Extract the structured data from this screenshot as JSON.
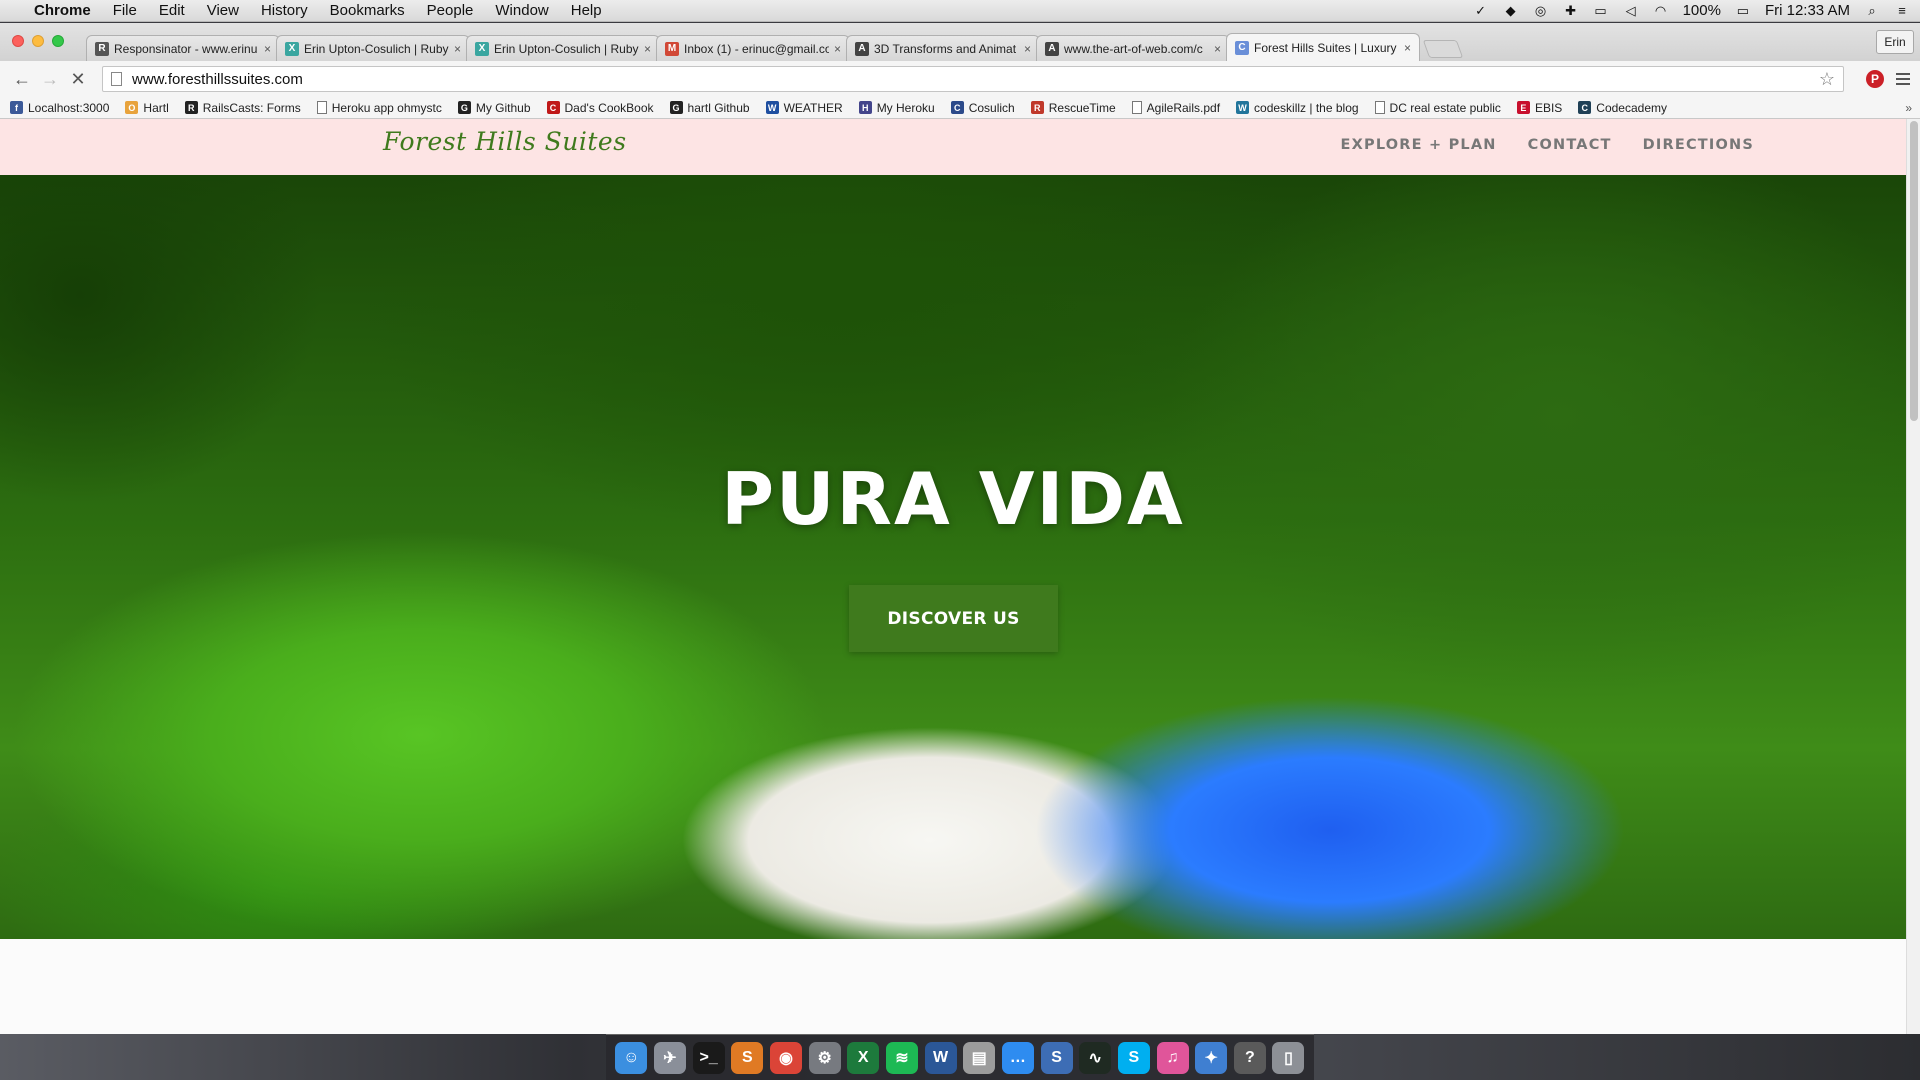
{
  "menubar": {
    "app_name": "Chrome",
    "items": [
      "File",
      "Edit",
      "View",
      "History",
      "Bookmarks",
      "People",
      "Window",
      "Help"
    ],
    "battery": "100%",
    "clock": "Fri 12:33 AM"
  },
  "tabs": [
    {
      "title": "Responsinator - www.erinu",
      "icon": "R",
      "color": "#555555"
    },
    {
      "title": "Erin Upton-Cosulich | Ruby",
      "icon": "X",
      "color": "#3aa6a0"
    },
    {
      "title": "Erin Upton-Cosulich | Ruby",
      "icon": "X",
      "color": "#3aa6a0"
    },
    {
      "title": "Inbox (1) - erinuc@gmail.co",
      "icon": "M",
      "color": "#d14836"
    },
    {
      "title": "3D Transforms and Animat",
      "icon": "A",
      "color": "#444444"
    },
    {
      "title": "www.the-art-of-web.com/c",
      "icon": "A",
      "color": "#444444"
    },
    {
      "title": "Forest Hills Suites | Luxury",
      "icon": "C",
      "color": "#6a8fd8"
    }
  ],
  "profile_name": "Erin",
  "address_bar": {
    "url": "www.foresthillssuites.com"
  },
  "bookmarks": [
    {
      "label": "Localhost:3000",
      "icon": "f",
      "color": "#3b5998"
    },
    {
      "label": "Hartl",
      "icon": "O",
      "color": "#e8a33c"
    },
    {
      "label": "RailsCasts: Forms",
      "icon": "R",
      "color": "#222222"
    },
    {
      "label": "Heroku app ohmystc",
      "icon": "doc",
      "color": "#ffffff"
    },
    {
      "label": "My Github",
      "icon": "G",
      "color": "#222222"
    },
    {
      "label": "Dad's CookBook",
      "icon": "C",
      "color": "#c01818"
    },
    {
      "label": "hartl Github",
      "icon": "G",
      "color": "#222222"
    },
    {
      "label": "WEATHER",
      "icon": "W",
      "color": "#1f4fa0"
    },
    {
      "label": "My Heroku",
      "icon": "H",
      "color": "#43458b"
    },
    {
      "label": "Cosulich",
      "icon": "C",
      "color": "#2c4a8a"
    },
    {
      "label": "RescueTime",
      "icon": "R",
      "color": "#c0392b"
    },
    {
      "label": "AgileRails.pdf",
      "icon": "doc",
      "color": "#ffffff"
    },
    {
      "label": "codeskillz | the blog",
      "icon": "W",
      "color": "#21759b"
    },
    {
      "label": "DC real estate public",
      "icon": "doc",
      "color": "#ffffff"
    },
    {
      "label": "EBIS",
      "icon": "E",
      "color": "#c8102e"
    },
    {
      "label": "Codecademy",
      "icon": "C",
      "color": "#1f4056"
    }
  ],
  "site": {
    "logo": "Forest Hills Suites",
    "nav": [
      "EXPLORE + PLAN",
      "CONTACT",
      "DIRECTIONS"
    ],
    "hero_title": "PURA VIDA",
    "hero_button": "DISCOVER US",
    "brand_color": "#3f7a1d",
    "nav_background": "#fde4e4"
  },
  "dock": [
    {
      "name": "finder-icon",
      "glyph": "☺",
      "color": "#3b8fe0"
    },
    {
      "name": "launchpad-icon",
      "glyph": "✈",
      "color": "#8a8f99"
    },
    {
      "name": "terminal-icon",
      "glyph": ">_",
      "color": "#1a1a1a"
    },
    {
      "name": "sublime-icon",
      "glyph": "S",
      "color": "#e07a24"
    },
    {
      "name": "chrome-icon",
      "glyph": "◉",
      "color": "#db4437"
    },
    {
      "name": "system-preferences-icon",
      "glyph": "⚙",
      "color": "#777a80"
    },
    {
      "name": "excel-icon",
      "glyph": "X",
      "color": "#1d7a3c"
    },
    {
      "name": "spotify-icon",
      "glyph": "≋",
      "color": "#1db954"
    },
    {
      "name": "word-icon",
      "glyph": "W",
      "color": "#2b5797"
    },
    {
      "name": "notes-icon",
      "glyph": "▤",
      "color": "#9c9c9c"
    },
    {
      "name": "messages-icon",
      "glyph": "…",
      "color": "#2e8cf0"
    },
    {
      "name": "scrivener-icon",
      "glyph": "S",
      "color": "#3d6db5"
    },
    {
      "name": "activity-monitor-icon",
      "glyph": "∿",
      "color": "#1f2a22"
    },
    {
      "name": "skype-icon",
      "glyph": "S",
      "color": "#00aff0"
    },
    {
      "name": "itunes-icon",
      "glyph": "♫",
      "color": "#e0559a"
    },
    {
      "name": "xcode-icon",
      "glyph": "✦",
      "color": "#3f7fd1"
    },
    {
      "name": "help-icon",
      "glyph": "?",
      "color": "#5a5a5a"
    },
    {
      "name": "trash-icon",
      "glyph": "▯",
      "color": "#8d9096"
    }
  ]
}
